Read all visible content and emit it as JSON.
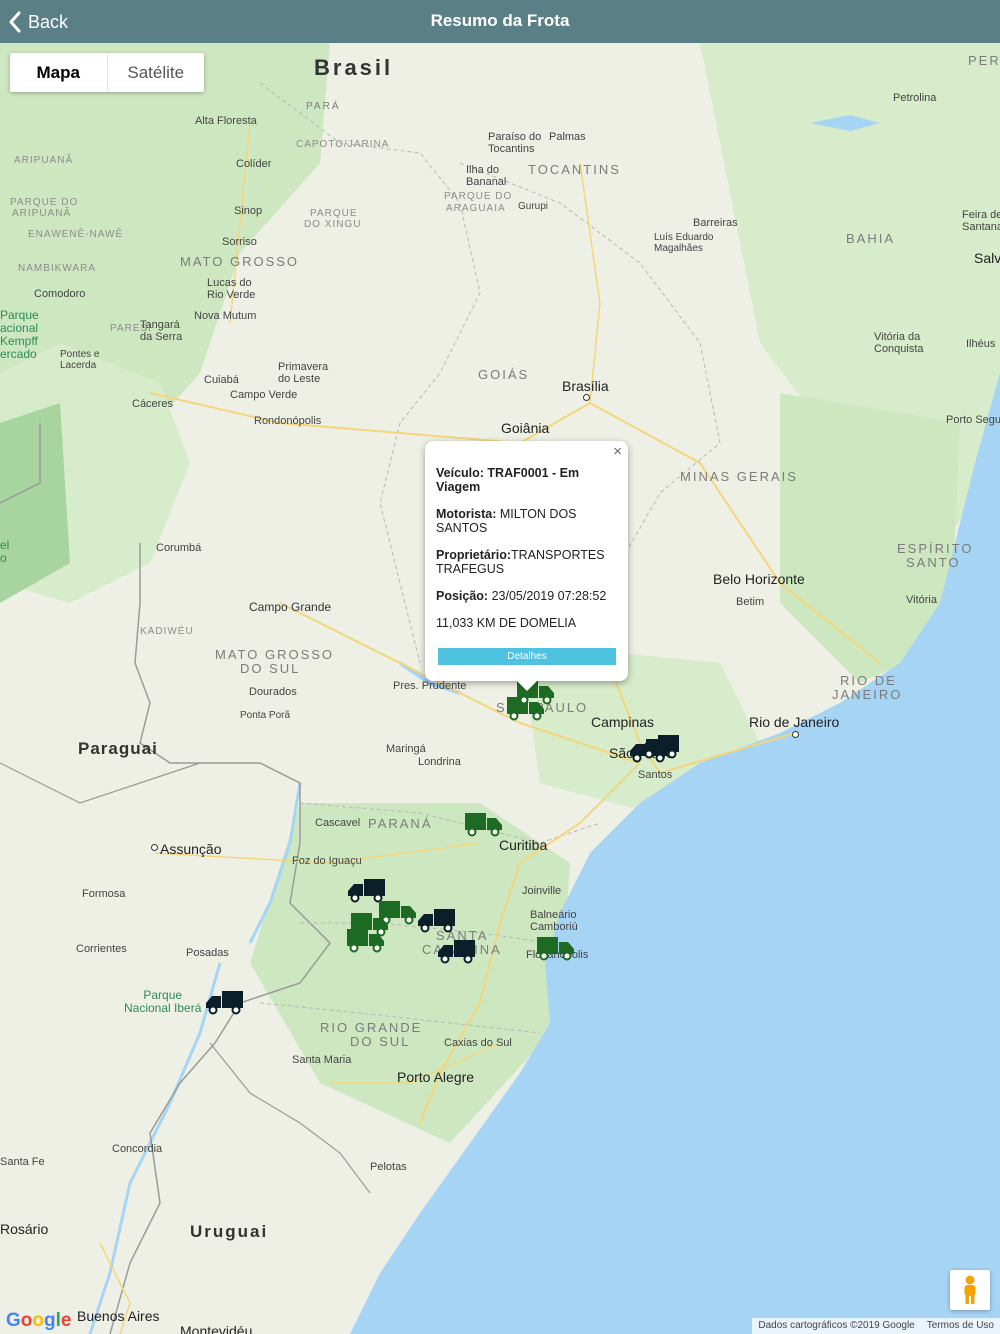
{
  "header": {
    "back_label": "Back",
    "title": "Resumo da Frota"
  },
  "map_type": {
    "map_label": "Mapa",
    "satellite_label": "Satélite",
    "selected": "Mapa"
  },
  "map_labels": {
    "countries": {
      "brasil": "Brasil",
      "paraguai": "Paraguai",
      "uruguai": "Uruguai",
      "peru": "PER"
    },
    "states": {
      "para": "PARÁ",
      "tocantins": "TOCANTINS",
      "bahia": "BAHIA",
      "mato_grosso": "MATO GROSSO",
      "goias": "GOIÁS",
      "minas_gerais": "MINAS GERAIS",
      "espirito_santo_1": "ESPÍRITO",
      "espirito_santo_2": "SANTO",
      "mato_grosso_do_sul_1": "MATO GROSSO",
      "mato_grosso_do_sul_2": "DO SUL",
      "rio_de_janeiro_1": "RIO DE",
      "rio_de_janeiro_2": "JANEIRO",
      "sao_paulo": "SÃO PAULO",
      "parana": "PARANÁ",
      "santa_catarina_1": "SANTA",
      "santa_catarina_2": "CATARINA",
      "rio_grande_do_sul_1": "RIO GRANDE",
      "rio_grande_do_sul_2": "DO SUL"
    },
    "parks": {
      "capoto": "CAPOTO/JARINA",
      "aripuana": "ARIPUANÃ",
      "parque_aripuana_1": "PARQUE DO",
      "parque_aripuana_2": "ARIPUANÃ",
      "enawene": "ENAWENÊ-NAWÊ",
      "nambikwara": "NAMBIKWARA",
      "paresi": "PARESI",
      "xingu_1": "PARQUE",
      "xingu_2": "DO XINGU",
      "araguaia_1": "PARQUE DO",
      "araguaia_2": "ARAGUAIA",
      "kadiweu": "KADIWÉU",
      "parque_kempff": "Parque\nacional\nKempff\nercado",
      "ibera": "Parque\nNacional Iberá",
      "el_o": "el\no"
    },
    "cities": {
      "alta_floresta": "Alta Floresta",
      "colider": "Colíder",
      "sinop": "Sinop",
      "sorriso": "Sorriso",
      "lucas": "Lucas do\nRio Verde",
      "nova_mutum": "Nova Mutum",
      "comodoro": "Comodoro",
      "tangara": "Tangará\nda Serra",
      "pontes": "Pontes e\nLacerda",
      "primavera": "Primavera\ndo Leste",
      "cuiaba": "Cuiabá",
      "campo_verde": "Campo Verde",
      "caceres": "Cáceres",
      "rondonopolis": "Rondonópolis",
      "corumba": "Corumbá",
      "campo_grande": "Campo Grande",
      "dourados": "Dourados",
      "ponta_pora": "Ponta Porã",
      "paraiso": "Paraíso do\nTocantins",
      "palmas": "Palmas",
      "ilha": "Ilha do\nBananal",
      "gurupi": "Gurupi",
      "barreiras": "Barreiras",
      "luis": "Luís Eduardo\nMagalhães",
      "petrolina": "Petrolina",
      "feira": "Feira de\nSantana",
      "salvador": "Salv",
      "vitoria_conquista": "Vitória da\nConquista",
      "ilheus": "Ilhéus",
      "porto_seguro": "Porto Segu",
      "brasilia": "Brasília",
      "goiania": "Goiânia",
      "belo_horizonte": "Belo Horizonte",
      "betim": "Betim",
      "vitoria": "Vitória",
      "pres_prudente": "Pres. Prudente",
      "campinas": "Campinas",
      "rio": "Rio de Janeiro",
      "sao_paulo_city": "São Paulo",
      "santos": "Santos",
      "maringa": "Maringá",
      "londrina": "Londrina",
      "cascavel": "Cascavel",
      "curitiba": "Curitiba",
      "assuncao": "Assunção",
      "foz": "Foz do Iguaçu",
      "formosa": "Formosa",
      "joinville": "Joinville",
      "balneario": "Balneário\nCamboriú",
      "florianopolis": "Florianópolis",
      "corrientes": "Corrientes",
      "posadas": "Posadas",
      "caxias": "Caxias do Sul",
      "santa_maria": "Santa Maria",
      "porto_alegre": "Porto Alegre",
      "pelotas": "Pelotas",
      "concordia": "Concordia",
      "santa_fe": "Santa Fe",
      "rosario": "Rosário",
      "buenos_aires": "Buenos Aires",
      "montevideu": "Montevidéu"
    }
  },
  "popup": {
    "vehicle_label": "Veículo:",
    "vehicle_value": " TRAF0001 - Em Viagem",
    "driver_label": "Motorista:",
    "driver_value": " MILTON DOS SANTOS",
    "owner_label": "Proprietário:",
    "owner_value": "TRANSPORTES TRAFEGUS",
    "position_label": "Posição:",
    "position_value": " 23/05/2019 07:28:52",
    "location": "11,033 KM DE DOMELIA",
    "details_button": "Detalhes",
    "close_icon": "×"
  },
  "markers": {
    "colors": {
      "moving": "#1d6b22",
      "stopped": "#0b1f2a"
    },
    "icon": "truck-icon",
    "count": 18
  },
  "footer": {
    "google": [
      "G",
      "o",
      "o",
      "g",
      "l",
      "e"
    ],
    "attribution": "Dados cartográficos ©2019 Google",
    "terms": "Termos de Uso"
  },
  "colors": {
    "header_bg": "#5b7f87",
    "ocean": "#a6d4f5",
    "land": "#eef0e6",
    "forest": "#cde8c0",
    "details_button": "#4fc2e0"
  }
}
